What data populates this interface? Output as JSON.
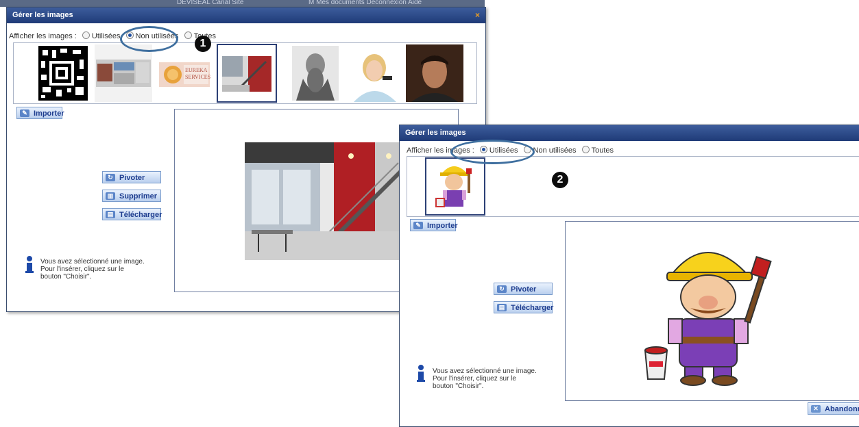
{
  "background_bar": {
    "text": "DEVISEAL Canal Site",
    "right_text": "M Mes documents  Déconnexion  Aide"
  },
  "dialog1": {
    "title": "Gérer les images",
    "close": "×",
    "filter_label": "Afficher les images :",
    "filter_options": [
      {
        "label": "Utilisées",
        "selected": false
      },
      {
        "label": "Non utilisées",
        "selected": true
      },
      {
        "label": "Toutes",
        "selected": false
      }
    ],
    "thumbnails": [
      "qr-code",
      "kitchen",
      "eureka-services-logo",
      "staircase",
      "drawing-portrait",
      "call-center-woman",
      "man-portrait"
    ],
    "eureka_text": "EUREKA\nSERVICES",
    "import_label": "Importer",
    "rotate_label": "Pivoter",
    "delete_label": "Supprimer",
    "download_label": "Télécharger",
    "info_lines": [
      "Vous avez sélectionné une image.",
      "Pour l'insérer, cliquez sur le",
      "bouton \"Choisir\"."
    ],
    "badge": "1"
  },
  "dialog2": {
    "title": "Gérer les images",
    "filter_label": "Afficher les images :",
    "filter_options": [
      {
        "label": "Utilisées",
        "selected": true
      },
      {
        "label": "Non utilisées",
        "selected": false
      },
      {
        "label": "Toutes",
        "selected": false
      }
    ],
    "thumbnails": [
      "painter-cartoon"
    ],
    "import_label": "Importer",
    "rotate_label": "Pivoter",
    "download_label": "Télécharger",
    "info_lines": [
      "Vous avez sélectionné une image.",
      "Pour l'insérer, cliquez sur le",
      "bouton \"Choisir\"."
    ],
    "cancel_label": "Abandonner",
    "badge": "2"
  },
  "colors": {
    "titlebar": "#2a4582",
    "button_text": "#1e3d8f",
    "highlight_ellipse": "#3f6f9f"
  }
}
